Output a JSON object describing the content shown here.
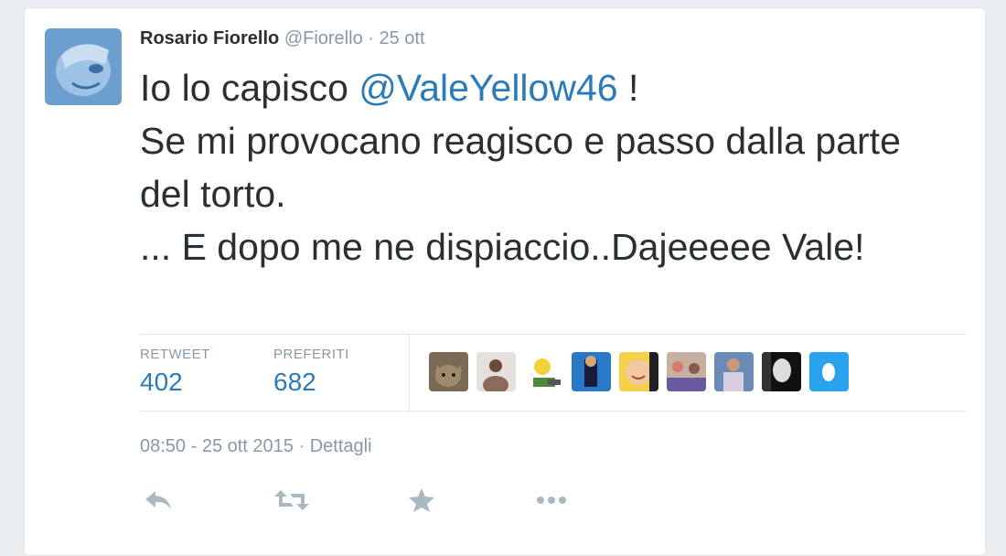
{
  "tweet": {
    "author_name": "Rosario Fiorello",
    "author_handle": "@Fiorello",
    "separator": "·",
    "date_short": "25 ott",
    "text_before_mention": "Io lo capisco ",
    "mention": "@ValeYellow46",
    "text_after_mention": " !",
    "line2": "Se mi provocano reagisco e passo dalla parte del torto.",
    "line3": "... E dopo me ne dispiaccio..Dajeeeee Vale!"
  },
  "stats": {
    "retweet_label": "RETWEET",
    "retweet_count": "402",
    "favorites_label": "PREFERITI",
    "favorites_count": "682"
  },
  "favoriters": [
    {
      "icon": "avatar-cat"
    },
    {
      "icon": "avatar-woman"
    },
    {
      "icon": "avatar-cartoon"
    },
    {
      "icon": "avatar-blue-figure"
    },
    {
      "icon": "avatar-smiling-face"
    },
    {
      "icon": "avatar-group"
    },
    {
      "icon": "avatar-person"
    },
    {
      "icon": "avatar-bw-portrait"
    },
    {
      "icon": "avatar-blue-egg"
    }
  ],
  "footer": {
    "timestamp": "08:50 - 25 ott 2015",
    "separator": "·",
    "details_label": "Dettagli"
  },
  "actions": [
    {
      "icon": "reply-icon"
    },
    {
      "icon": "retweet-icon"
    },
    {
      "icon": "favorite-star-icon"
    },
    {
      "icon": "more-icon"
    }
  ],
  "colors": {
    "link": "#2b7bb9",
    "muted": "#8899a6",
    "text": "#292f33",
    "icon": "#aab8c2"
  }
}
